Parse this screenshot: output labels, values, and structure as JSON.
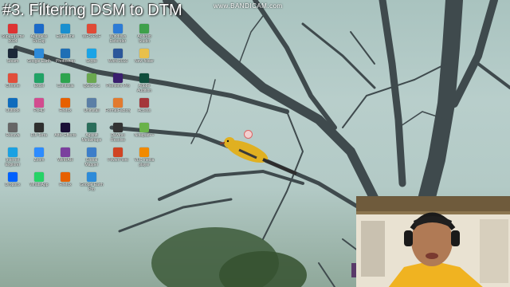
{
  "title": "#3. Filtering DSM to DTM",
  "watermark": "www.BANDICAM.com",
  "colors": {
    "sky": "#b3cac6",
    "branch": "#3f4a4d",
    "bird": "#e0b021"
  },
  "desktop_icons": [
    {
      "label": "Superprisme 2014",
      "icon": "red-circle-app-icon",
      "color": "#d33"
    },
    {
      "label": "Autodesk ReCap",
      "icon": "autodesk-icon",
      "color": "#1b6ac9"
    },
    {
      "label": "Earth Link",
      "icon": "earth-icon",
      "color": "#1a8fcf"
    },
    {
      "label": "WPS PDF",
      "icon": "wps-pdf-icon",
      "color": "#e04a36"
    },
    {
      "label": "Windows Defender",
      "icon": "shield-icon",
      "color": "#2c7bd6"
    },
    {
      "label": "Android Studio",
      "icon": "android-icon",
      "color": "#3ea04b"
    },
    {
      "label": "Steam",
      "icon": "steam-icon",
      "color": "#1b2838"
    },
    {
      "label": "Google Earth",
      "icon": "google-earth-icon",
      "color": "#2d8bd9"
    },
    {
      "label": "Photoshop",
      "icon": "photoshop-icon",
      "color": "#1f6fb5"
    },
    {
      "label": "Skype",
      "icon": "skype-icon",
      "color": "#1aa4e6"
    },
    {
      "label": "Word 2016",
      "icon": "word-icon",
      "color": "#2b579a"
    },
    {
      "label": "New folder",
      "icon": "folder-icon",
      "color": "#e8c04b"
    },
    {
      "label": "Chrome",
      "icon": "chrome-icon",
      "color": "#e14e3b"
    },
    {
      "label": "Excel",
      "icon": "excel-icon",
      "color": "#21a366"
    },
    {
      "label": "Camtasia",
      "icon": "camtasia-icon",
      "color": "#2da44e"
    },
    {
      "label": "QGIS 3.1",
      "icon": "qgis-icon",
      "color": "#6aa84f"
    },
    {
      "label": "Premiere Pro",
      "icon": "premiere-icon",
      "color": "#3a1f6e"
    },
    {
      "label": "Adobe Audition",
      "icon": "audition-icon",
      "color": "#0e4d3b"
    },
    {
      "label": "Outlook",
      "icon": "outlook-icon",
      "color": "#0f6cbd"
    },
    {
      "label": "Pix4D",
      "icon": "pix4d-icon",
      "color": "#d24c8f"
    },
    {
      "label": "Firefox",
      "icon": "firefox-icon",
      "color": "#e66000"
    },
    {
      "label": "Uninstall",
      "icon": "uninstall-icon",
      "color": "#5b7fa6"
    },
    {
      "label": "FormatFactory",
      "icon": "factory-icon",
      "color": "#e27a2f"
    },
    {
      "label": "Access",
      "icon": "access-icon",
      "color": "#a4373a"
    },
    {
      "label": "Recuva",
      "icon": "recuva-icon",
      "color": "#666"
    },
    {
      "label": "DJI Terra",
      "icon": "dji-icon",
      "color": "#2f2f2f"
    },
    {
      "label": "After Effects",
      "icon": "after-effects-icon",
      "color": "#1a0f36"
    },
    {
      "label": "Agisoft Metashape",
      "icon": "metashape-icon",
      "color": "#2a6d5a"
    },
    {
      "label": "DaVinci Resolve",
      "icon": "davinci-icon",
      "color": "#333"
    },
    {
      "label": "Notepad++",
      "icon": "notepad-icon",
      "color": "#69b24a"
    },
    {
      "label": "Internet Explorer",
      "icon": "ie-icon",
      "color": "#1ba1e2"
    },
    {
      "label": "Zoom",
      "icon": "zoom-icon",
      "color": "#2d8cff"
    },
    {
      "label": "WinRAR",
      "icon": "winrar-icon",
      "color": "#7b3f9e"
    },
    {
      "label": "Global Mapper",
      "icon": "global-mapper-icon",
      "color": "#3d7ec9"
    },
    {
      "label": "PowerPoint",
      "icon": "powerpoint-icon",
      "color": "#d04423"
    },
    {
      "label": "VLC media player",
      "icon": "vlc-icon",
      "color": "#f18a00"
    },
    {
      "label": "Dropbox",
      "icon": "dropbox-icon",
      "color": "#0061fe"
    },
    {
      "label": "WhatsApp",
      "icon": "whatsapp-icon",
      "color": "#25d366"
    },
    {
      "label": "Firefox",
      "icon": "firefox-icon",
      "color": "#e66000"
    },
    {
      "label": "Google Earth Pro",
      "icon": "google-earth-icon",
      "color": "#2d8bd9"
    }
  ]
}
